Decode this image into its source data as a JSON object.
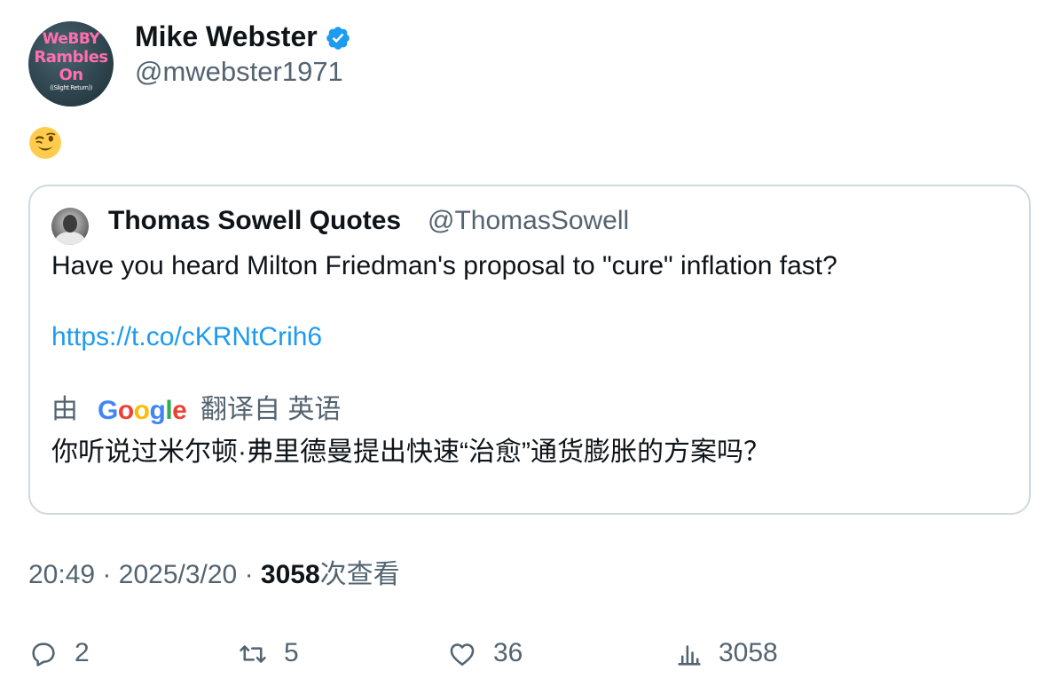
{
  "author": {
    "name": "Mike Webster",
    "handle": "@mwebster1971",
    "avatar_text": [
      "WeBBY",
      "Rambles",
      "On",
      "((Slight Return))"
    ],
    "verified": true
  },
  "tweet": {
    "emoji": "winking-face"
  },
  "quoted": {
    "name": "Thomas Sowell Quotes",
    "handle": "@ThomasSowell",
    "text": "Have you heard Milton Friedman's proposal to \"cure\" inflation fast?",
    "link": "https://t.co/cKRNtCrih6",
    "translate_by": "由",
    "translate_from": "翻译自 英语",
    "translation": "你听说过米尔顿·弗里德曼提出快速“治愈”通货膨胀的方案吗？"
  },
  "meta": {
    "time": "20:49",
    "sep": "·",
    "date": "2025/3/20",
    "views_count": "3058",
    "views_label": "次查看"
  },
  "actions": {
    "replies": "2",
    "retweets": "5",
    "likes": "36",
    "views": "3058"
  },
  "colors": {
    "link": "#1d9bf0",
    "verified": "#1d9bf0",
    "secondary_text": "#536471",
    "border": "#cfd9de"
  }
}
